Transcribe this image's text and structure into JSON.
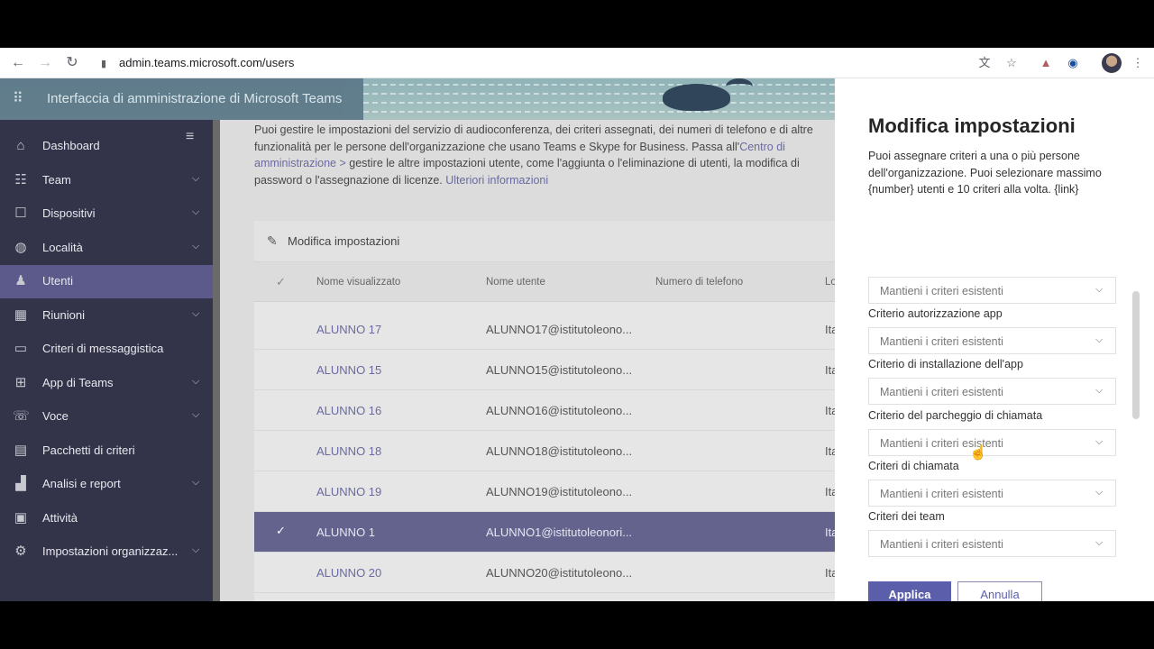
{
  "browser": {
    "url": "admin.teams.microsoft.com/users"
  },
  "header": {
    "title": "Interfaccia di amministrazione di Microsoft Teams"
  },
  "sidebar": {
    "items": [
      {
        "label": "Dashboard",
        "icon": "home-icon",
        "glyph": "⌂",
        "expandable": false,
        "active": false
      },
      {
        "label": "Team",
        "icon": "team-icon",
        "glyph": "☷",
        "expandable": true,
        "active": false
      },
      {
        "label": "Dispositivi",
        "icon": "devices-icon",
        "glyph": "☐",
        "expandable": true,
        "active": false
      },
      {
        "label": "Località",
        "icon": "globe-icon",
        "glyph": "◍",
        "expandable": true,
        "active": false
      },
      {
        "label": "Utenti",
        "icon": "users-icon",
        "glyph": "♟",
        "expandable": false,
        "active": true
      },
      {
        "label": "Riunioni",
        "icon": "calendar-icon",
        "glyph": "▦",
        "expandable": true,
        "active": false
      },
      {
        "label": "Criteri di messaggistica",
        "icon": "chat-icon",
        "glyph": "▭",
        "expandable": false,
        "active": false
      },
      {
        "label": "App di Teams",
        "icon": "apps-icon",
        "glyph": "⊞",
        "expandable": true,
        "active": false
      },
      {
        "label": "Voce",
        "icon": "voice-icon",
        "glyph": "☏",
        "expandable": true,
        "active": false
      },
      {
        "label": "Pacchetti di criteri",
        "icon": "package-icon",
        "glyph": "▤",
        "expandable": false,
        "active": false
      },
      {
        "label": "Analisi e report",
        "icon": "analytics-icon",
        "glyph": "▟",
        "expandable": true,
        "active": false
      },
      {
        "label": "Attività",
        "icon": "activity-icon",
        "glyph": "▣",
        "expandable": false,
        "active": false
      },
      {
        "label": "Impostazioni organizzaz...",
        "icon": "settings-icon",
        "glyph": "⚙",
        "expandable": true,
        "active": false
      }
    ]
  },
  "main": {
    "intro_text": "Puoi gestire le impostazioni del servizio di audioconferenza, dei criteri assegnati, dei numeri di telefono e di altre funzionalità per le persone dell'organizzazione che usano Teams e Skype for Business. Passa all'",
    "intro_link": "Centro di amministrazione >",
    "intro_text2": " gestire le altre impostazioni utente, come l'aggiunta o l'eliminazione di utenti, la modifica di password o l'assegnazione di licenze. ",
    "intro_link2": "Ulteriori informazioni",
    "card_title": "Modifica impostazioni",
    "columns": [
      "Nome visualizzato",
      "Nome utente",
      "Numero di telefono",
      "Lo"
    ],
    "rows": [
      {
        "name": "ALUNNO 17",
        "user": "ALUNNO17@istitutoleono...",
        "loc": "Ita",
        "selected": false
      },
      {
        "name": "ALUNNO 15",
        "user": "ALUNNO15@istitutoleono...",
        "loc": "Ita",
        "selected": false
      },
      {
        "name": "ALUNNO 16",
        "user": "ALUNNO16@istitutoleono...",
        "loc": "Ita",
        "selected": false
      },
      {
        "name": "ALUNNO 18",
        "user": "ALUNNO18@istitutoleono...",
        "loc": "Ita",
        "selected": false
      },
      {
        "name": "ALUNNO 19",
        "user": "ALUNNO19@istitutoleono...",
        "loc": "Ita",
        "selected": false
      },
      {
        "name": "ALUNNO 1",
        "user": "ALUNNO1@istitutoleonori...",
        "loc": "Ita",
        "selected": true
      },
      {
        "name": "ALUNNO 20",
        "user": "ALUNNO20@istitutoleono...",
        "loc": "Ita",
        "selected": false
      }
    ]
  },
  "panel": {
    "title": "Modifica impostazioni",
    "description": "Puoi assegnare criteri a una o più persone dell'organizzazione. Puoi selezionare massimo {number} utenti e 10 criteri alla volta. {link}",
    "fields": [
      {
        "label": "",
        "value": "Mantieni i criteri esistenti"
      },
      {
        "label": "Criterio autorizzazione app",
        "value": "Mantieni i criteri esistenti"
      },
      {
        "label": "Criterio di installazione dell'app",
        "value": "Mantieni i criteri esistenti"
      },
      {
        "label": "Criterio del parcheggio di chiamata",
        "value": "Mantieni i criteri esistenti"
      },
      {
        "label": "Criteri di chiamata",
        "value": "Mantieni i criteri esistenti"
      },
      {
        "label": "Criteri dei team",
        "value": "Mantieni i criteri esistenti"
      }
    ],
    "apply_label": "Applica",
    "cancel_label": "Annulla"
  }
}
